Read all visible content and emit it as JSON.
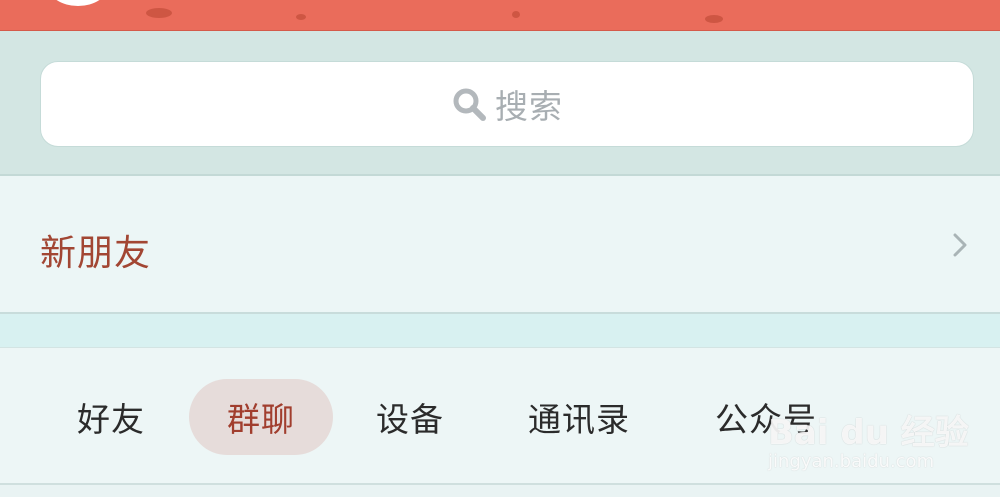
{
  "search": {
    "placeholder": "搜索",
    "icon": "search-icon"
  },
  "new_friend": {
    "label": "新朋友",
    "icon": "chevron-right-icon"
  },
  "tabs": [
    {
      "label": "好友",
      "active": false
    },
    {
      "label": "群聊",
      "active": true
    },
    {
      "label": "设备",
      "active": false
    },
    {
      "label": "通讯录",
      "active": false
    },
    {
      "label": "公众号",
      "active": false
    }
  ],
  "watermark": {
    "main": "Bai du 经验",
    "sub": "jingyan.baidu.com"
  },
  "colors": {
    "topbar": "#ea6c5b",
    "accent_text": "#a24633",
    "active_tab_bg": "#e6dcda",
    "search_zone": "#d3e6e3"
  }
}
